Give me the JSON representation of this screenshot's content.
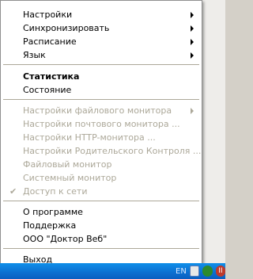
{
  "menu": {
    "submenus": [
      {
        "label": "Настройки"
      },
      {
        "label": "Синхронизировать"
      },
      {
        "label": "Расписание"
      },
      {
        "label": "Язык"
      }
    ],
    "statistics_label": "Статистика",
    "state_label": "Состояние",
    "disabled_items": [
      {
        "label": "Настройки файлового монитора"
      },
      {
        "label": "Настройки почтового монитора ..."
      },
      {
        "label": "Настройки HTTP-монитора ..."
      },
      {
        "label": "Настройки Родительского Контроля ..."
      },
      {
        "label": "Файловый монитор"
      },
      {
        "label": "Системный монитор"
      },
      {
        "label": "Доступ к сети",
        "checked": true
      }
    ],
    "about_label": "О программе",
    "support_label": "Поддержка",
    "company_label": "ООО \"Доктор Веб\"",
    "exit_label": "Выход"
  },
  "taskbar": {
    "language": "EN"
  }
}
